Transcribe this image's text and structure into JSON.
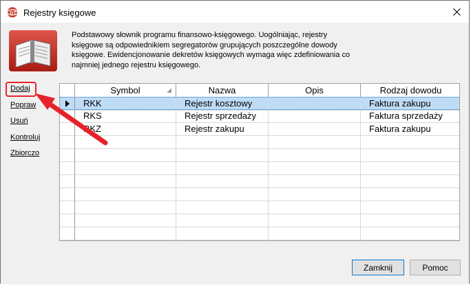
{
  "window": {
    "title": "Rejestry księgowe"
  },
  "description": "Podstawowy słownik programu finansowo-księgowego. Uogólniając, rejestry księgowe są odpowiednikiem segregatorów grupujących poszczególne dowody księgowe. Ewidencjonowanie dekretów księgowych wymaga więc zdefiniowania co najmniej jednego rejestru księgowego.",
  "sidebar": {
    "links": [
      "Dodaj",
      "Popraw",
      "Usuń",
      "Kontroluj",
      "Zbiorczo"
    ]
  },
  "grid": {
    "columns": [
      "Symbol",
      "Nazwa",
      "Opis",
      "Rodzaj dowodu"
    ],
    "rows": [
      {
        "symbol": "RKK",
        "nazwa": "Rejestr kosztowy",
        "opis": "",
        "rodzaj": "Faktura zakupu",
        "selected": true
      },
      {
        "symbol": "RKS",
        "nazwa": "Rejestr sprzedaży",
        "opis": "",
        "rodzaj": "Faktura sprzedaży",
        "selected": false
      },
      {
        "symbol": "RKZ",
        "nazwa": "Rejestr zakupu",
        "opis": "",
        "rodzaj": "Faktura zakupu",
        "selected": false
      }
    ]
  },
  "buttons": {
    "close": "Zamknij",
    "help": "Pomoc"
  },
  "colors": {
    "selected_row": "#bfdcf7",
    "annotation": "#e8222a"
  }
}
